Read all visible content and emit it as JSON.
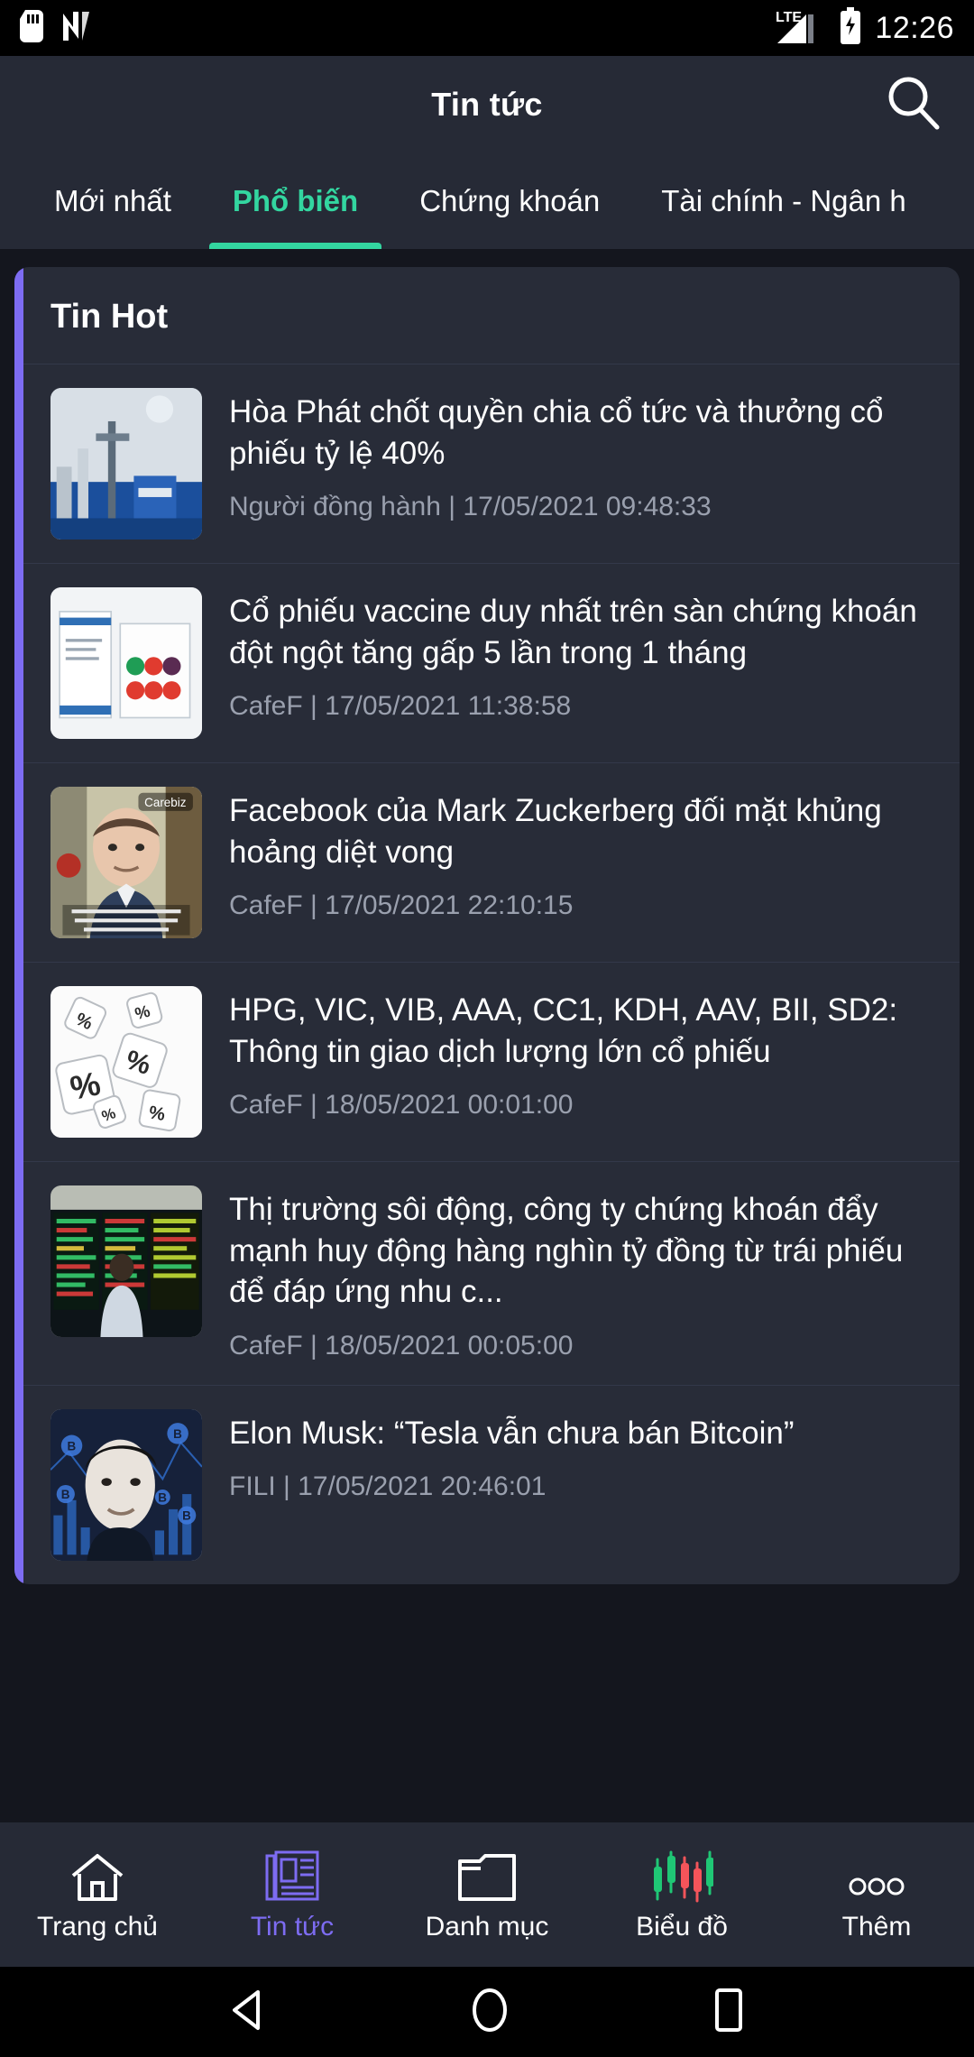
{
  "status_bar": {
    "icons": [
      "sd-card-icon",
      "nfc-icon",
      "lte-signal-icon",
      "battery-charging-icon"
    ],
    "network": "LTE",
    "time": "12:26"
  },
  "app_bar": {
    "title": "Tin tức",
    "search_icon": "search-icon"
  },
  "tabs": [
    {
      "label": "Mới nhất",
      "active": false
    },
    {
      "label": "Phổ biến",
      "active": true
    },
    {
      "label": "Chứng khoán",
      "active": false
    },
    {
      "label": "Tài chính - Ngân h",
      "active": false
    }
  ],
  "section": {
    "title": "Tin Hot",
    "accent_color": "#7d6cf2"
  },
  "news": [
    {
      "title": "Hòa Phát chốt quyền chia cổ tức và thưởng cổ phiếu tỷ lệ 40%",
      "source": "Người đồng hành",
      "datetime": "17/05/2021 09:48:33",
      "meta": "Người đồng hành | 17/05/2021 09:48:33",
      "thumb": "industrial-plant-photo"
    },
    {
      "title": "Cổ phiếu vaccine duy nhất trên sàn chứng khoán đột ngột tăng gấp 5 lần trong 1 tháng",
      "source": "CafeF",
      "datetime": "17/05/2021 11:38:58",
      "meta": "CafeF | 17/05/2021 11:38:58",
      "thumb": "vaccine-box-photo"
    },
    {
      "title": "Facebook của Mark Zuckerberg đối mặt khủng hoảng diệt vong",
      "source": "CafeF",
      "datetime": "17/05/2021 22:10:15",
      "meta": "CafeF | 17/05/2021 22:10:15",
      "thumb": "mark-zuckerberg-photo"
    },
    {
      "title": "HPG, VIC, VIB, AAA, CC1, KDH, AAV, BII, SD2: Thông tin giao dịch lượng lớn cổ phiếu",
      "source": "CafeF",
      "datetime": "18/05/2021 00:01:00",
      "meta": "CafeF | 18/05/2021 00:01:00",
      "thumb": "percent-dice-photo"
    },
    {
      "title": "Thị trường sôi động, công ty chứng khoán đẩy mạnh huy động hàng nghìn tỷ đồng từ trái phiếu để đáp ứng nhu c...",
      "source": "CafeF",
      "datetime": "18/05/2021 00:05:00",
      "meta": "CafeF | 18/05/2021 00:05:00",
      "thumb": "trading-floor-photo"
    },
    {
      "title": "Elon Musk: “Tesla vẫn chưa bán Bitcoin”",
      "source": "FILI",
      "datetime": "17/05/2021 20:46:01",
      "meta": "FILI | 17/05/2021 20:46:01",
      "thumb": "elon-musk-bitcoin-photo"
    }
  ],
  "bottom_nav": [
    {
      "label": "Trang chủ",
      "icon": "home-icon",
      "active": false
    },
    {
      "label": "Tin tức",
      "icon": "newspaper-icon",
      "active": true
    },
    {
      "label": "Danh mục",
      "icon": "folder-icon",
      "active": false
    },
    {
      "label": "Biểu đồ",
      "icon": "candlestick-chart-icon",
      "active": false
    },
    {
      "label": "Thêm",
      "icon": "more-dots-icon",
      "active": false
    }
  ],
  "system_nav": [
    {
      "name": "back-button",
      "icon": "triangle-left-icon"
    },
    {
      "name": "home-button",
      "icon": "circle-icon"
    },
    {
      "name": "recents-button",
      "icon": "square-icon"
    }
  ],
  "colors": {
    "page_bg": "#14161e",
    "card_bg": "#282c38",
    "appbar_bg": "#262a36",
    "accent_green": "#33d6a0",
    "accent_purple": "#7d6cf2",
    "meta_text": "#9aa0ae"
  }
}
